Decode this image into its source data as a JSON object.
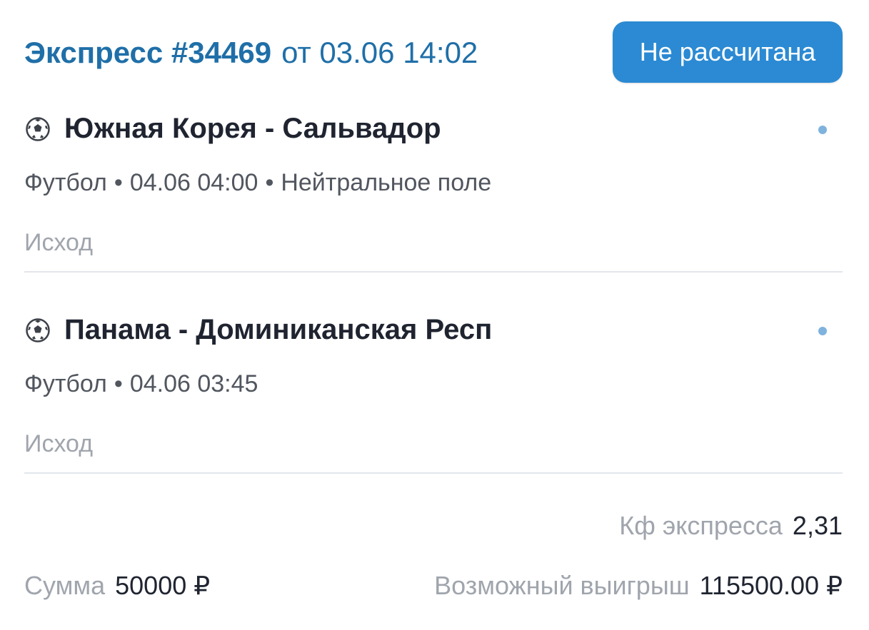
{
  "header": {
    "title_prefix": "Экспресс #34469",
    "date_text": "от 03.06 14:02",
    "status_label": "Не рассчитана",
    "status_color": "#2b8ad3",
    "title_color": "#1f6fa8"
  },
  "events": [
    {
      "icon": "soccer-ball-icon",
      "title": "Южная Корея - Сальвадор",
      "sport": "Футбол",
      "datetime": "04.06 04:00",
      "extra": "Нейтральное поле",
      "market": "Исход"
    },
    {
      "icon": "soccer-ball-icon",
      "title": "Панама - Доминиканская Респ",
      "sport": "Футбол",
      "datetime": "04.06 03:45",
      "market": "Исход"
    }
  ],
  "separator": "•",
  "summary": {
    "coef_label": "Кф экспресса",
    "coef_value": "2,31",
    "sum_label": "Сумма",
    "sum_value": "50000 ₽",
    "win_label": "Возможный выигрыш",
    "win_value": "115500.00 ₽"
  }
}
